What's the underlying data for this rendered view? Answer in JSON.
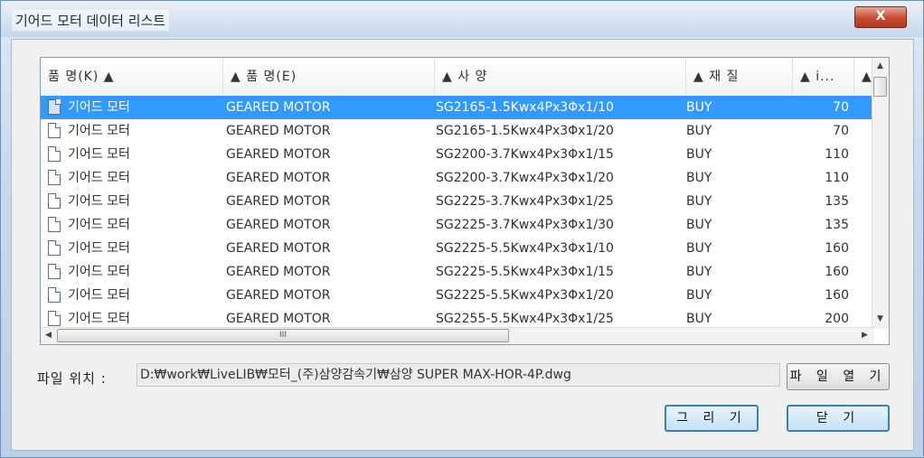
{
  "window": {
    "title": "기어드 모터 데이터 리스트",
    "close_label": "X"
  },
  "list": {
    "columns": [
      "품  명(K)  ▲",
      "▲  품  명(E)",
      "▲  사  양",
      "▲  재  질",
      "▲  i...",
      "▲"
    ],
    "rows": [
      [
        "기어드 모터",
        "GEARED MOTOR",
        "SG2165-1.5Kwx4Px3Φx1/10",
        "BUY",
        "70"
      ],
      [
        "기어드 모터",
        "GEARED MOTOR",
        "SG2165-1.5Kwx4Px3Φx1/20",
        "BUY",
        "70"
      ],
      [
        "기어드 모터",
        "GEARED MOTOR",
        "SG2200-3.7Kwx4Px3Φx1/15",
        "BUY",
        "110"
      ],
      [
        "기어드 모터",
        "GEARED MOTOR",
        "SG2200-3.7Kwx4Px3Φx1/20",
        "BUY",
        "110"
      ],
      [
        "기어드 모터",
        "GEARED MOTOR",
        "SG2225-3.7Kwx4Px3Φx1/25",
        "BUY",
        "135"
      ],
      [
        "기어드 모터",
        "GEARED MOTOR",
        "SG2225-3.7Kwx4Px3Φx1/30",
        "BUY",
        "135"
      ],
      [
        "기어드 모터",
        "GEARED MOTOR",
        "SG2225-5.5Kwx4Px3Φx1/10",
        "BUY",
        "160"
      ],
      [
        "기어드 모터",
        "GEARED MOTOR",
        "SG2225-5.5Kwx4Px3Φx1/15",
        "BUY",
        "160"
      ],
      [
        "기어드 모터",
        "GEARED MOTOR",
        "SG2225-5.5Kwx4Px3Φx1/20",
        "BUY",
        "160"
      ],
      [
        "기어드 모터",
        "GEARED MOTOR",
        "SG2255-5.5Kwx4Px3Φx1/25",
        "BUY",
        "200"
      ]
    ],
    "selected_row": 0,
    "hscroll_grip": "III"
  },
  "file": {
    "label": "파일 위치 :",
    "path": "D:₩work₩LiveLIB₩모터_(주)삼양감속기₩삼양 SUPER MAX-HOR-4P.dwg",
    "open_button": "파 일 열 기"
  },
  "buttons": {
    "draw": "그 리 기",
    "close": "닫  기"
  }
}
